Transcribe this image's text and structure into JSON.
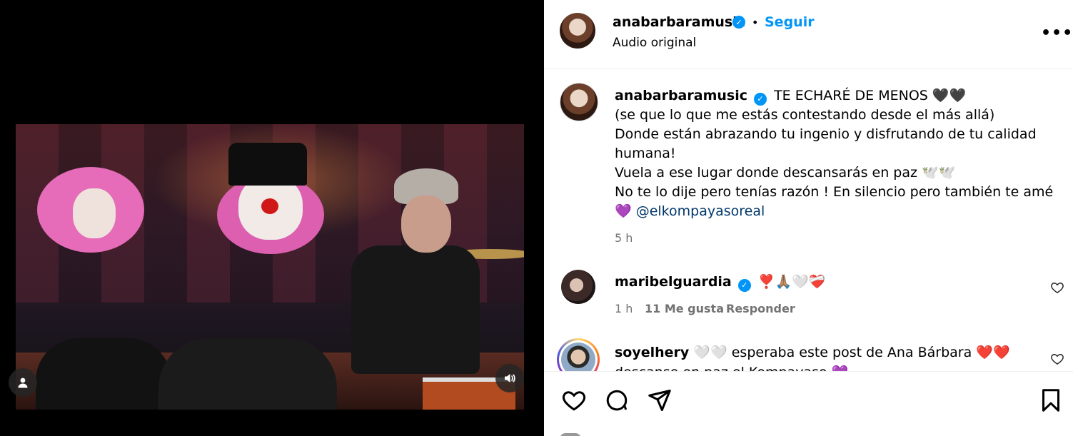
{
  "post": {
    "username": "anabarbaramusic",
    "follow_label": "Seguir",
    "dot": "•",
    "audio_label": "Audio original"
  },
  "caption": {
    "username": "anabarbaramusic",
    "line1": "TE ECHARÉ DE MENOS 🖤🖤",
    "line2": "(se que lo que me estás contestando desde el más allá)",
    "line3": "Donde están abrazando tu ingenio y disfrutando de tu calidad",
    "line4": "humana!",
    "line5": "Vuela a ese lugar donde descansarás en paz 🕊️🕊️",
    "line6": "No te lo dije pero tenías razón ! En silencio pero también te amé",
    "line7_emoji": "💜",
    "line7_mention": "@elkompayasoreal",
    "time": "5 h"
  },
  "comments": [
    {
      "username": "maribelguardia",
      "text": "❣️🙏🏽🤍❤️‍🩹",
      "time": "1 h",
      "likes": "11 Me gusta",
      "reply": "Responder"
    },
    {
      "username": "soyelhery",
      "text": "🤍🤍 esperaba este post de Ana Bárbara ❤️❤️",
      "text2": "descanse en paz el Kompayaso 💜"
    }
  ],
  "icons": {
    "verified": "verified-icon",
    "more": "more-options-icon",
    "like": "heart-icon",
    "comment": "comment-icon",
    "share": "share-icon",
    "save": "bookmark-icon",
    "sound": "volume-icon",
    "tagged": "user-icon"
  },
  "more_glyph": "•••",
  "verified_glyph": "✓",
  "colors": {
    "accent": "#0095f6",
    "mention": "#00376b",
    "muted": "#737373"
  }
}
